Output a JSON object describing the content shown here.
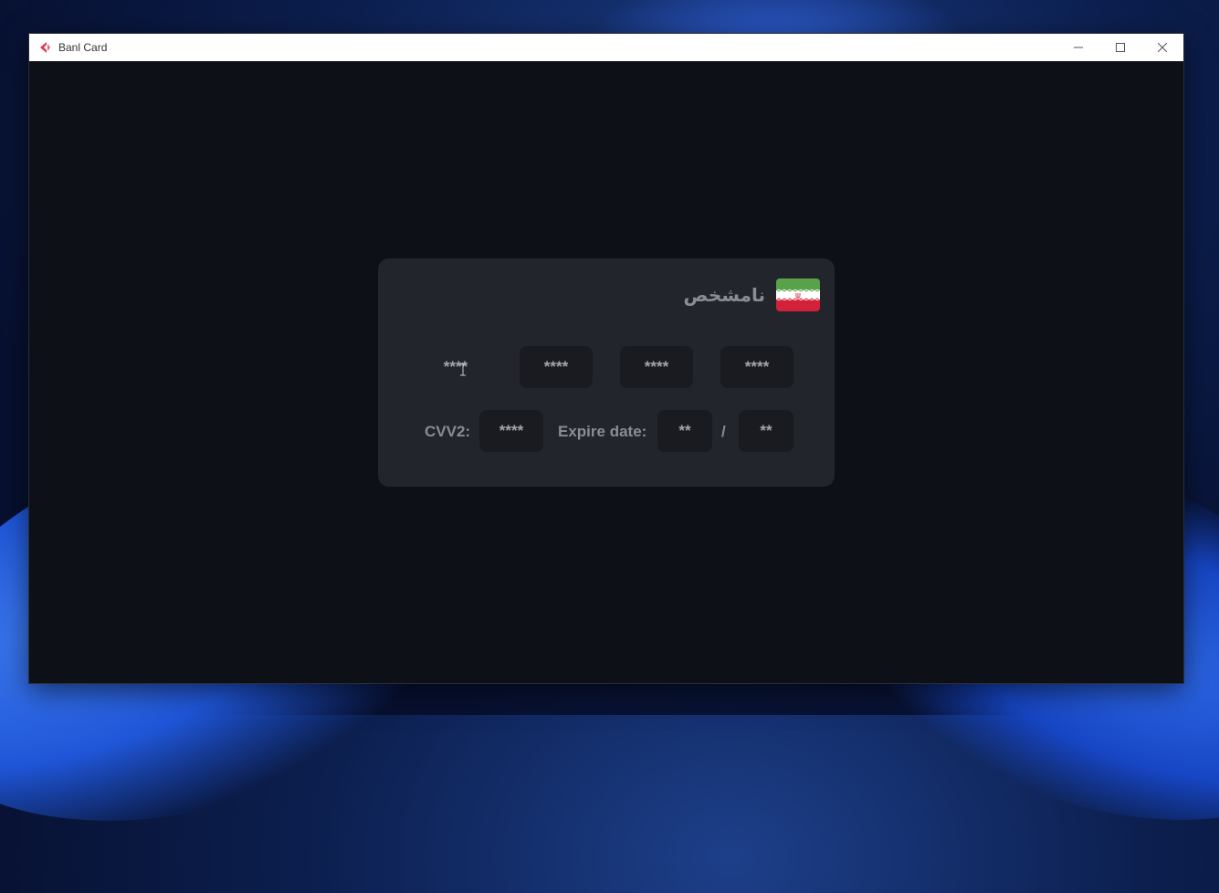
{
  "window": {
    "title": "Banl Card",
    "controls": [
      "minimize-icon",
      "maximize-icon",
      "close-icon"
    ]
  },
  "card": {
    "bank_name": "نامشخص",
    "flag_icon": "iran-flag-icon",
    "card_number": [
      "****",
      "****",
      "****",
      "****"
    ],
    "cvv_label": "CVV2:",
    "cvv_value": "****",
    "expire_label": "Expire date:",
    "expire_month": "**",
    "separator": "/",
    "expire_year": "**"
  },
  "colors": {
    "background": "#0e1018",
    "card": "#23252c",
    "field": "#191b21",
    "text": "#8b8d93"
  }
}
